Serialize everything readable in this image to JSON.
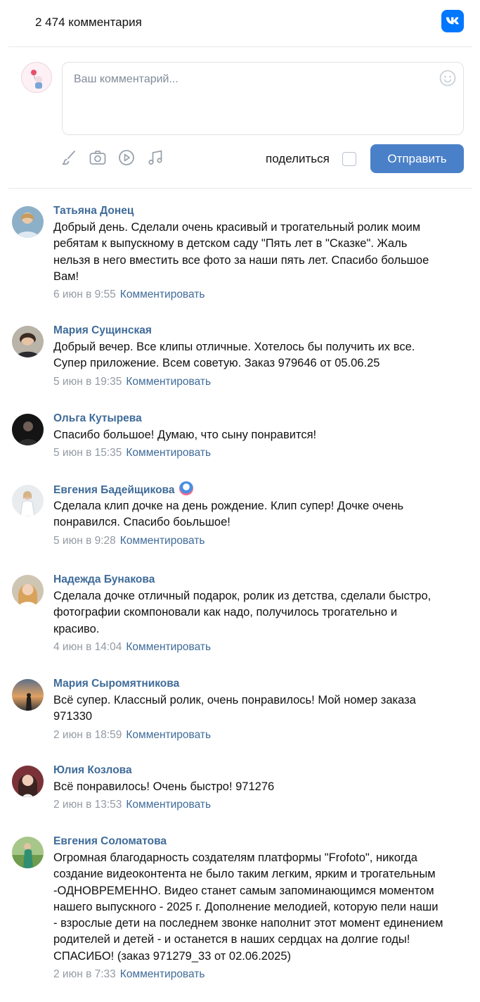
{
  "header": {
    "comment_count": "2 474 комментария",
    "logo_icon": "vk-logo-icon"
  },
  "composer": {
    "placeholder": "Ваш комментарий...",
    "emoji_icon": "smile-icon",
    "attachments": [
      "brush-icon",
      "camera-icon",
      "play-icon",
      "music-icon"
    ],
    "share_label": "поделиться",
    "send_label": "Отправить"
  },
  "colors": {
    "accent": "#4a80c8",
    "author": "#3f6b99",
    "meta": "#939aa3",
    "vk_brand": "#0077ff"
  },
  "comments": [
    {
      "author": "Татьяна Донец",
      "text": "Добрый день. Сделали очень красивый и трогательный ролик моим\nребятам к выпускному в детском саду \"Пять лет в \"Сказке\". Жаль\nнельзя в него вместить все фото за наши пять лет. Спасибо большое\nВам!",
      "date": "6 июн в 9:55",
      "reply": "Комментировать"
    },
    {
      "author": "Мария Сущинская",
      "text": "Добрый вечер. Все клипы отличные. Хотелось бы получить их все.\nСупер приложение. Всем советую. Заказ 979646 от 05.06.25",
      "date": "5 июн в 19:35",
      "reply": "Комментировать"
    },
    {
      "author": "Ольга Кутырева",
      "text": "Спасибо большое! Думаю, что сыну понравится!",
      "date": "5 июн в 15:35",
      "reply": "Комментировать"
    },
    {
      "author": "Евгения Бадейщикова",
      "text": "Сделала клип дочке на день рождение. Клип супер! Дочке очень\nпонравился. Спасибо боьльшое!",
      "date": "5 июн в 9:28",
      "reply": "Комментировать"
    },
    {
      "author": "Надежда Бунакова",
      "text": "Сделала дочке отличный подарок, ролик из детства, сделали быстро,\nфотографии скомпоновали как надо, получилось трогательно и\nкрасиво.",
      "date": "4 июн в 14:04",
      "reply": "Комментировать"
    },
    {
      "author": "Мария Сыромятникова",
      "text": "Всё супер. Классный ролик, очень понравилось! Мой номер заказа\n971330",
      "date": "2 июн в 18:59",
      "reply": "Комментировать"
    },
    {
      "author": "Юлия Козлова",
      "text": "Всё понравилось! Очень быстро! 971276",
      "date": "2 июн в 13:53",
      "reply": "Комментировать"
    },
    {
      "author": "Евгения Соломатова",
      "text": "Огромная благодарность создателям платформы \"Frofoto\", никогда\nсоздание видеоконтента не было таким легким, ярким и трогательным\n-ОДНОВРЕМЕННО. Видео станет самым запоминающимся моментом\nнашего выпускного - 2025 г. Дополнение мелодией, которую пели наши\n- взрослые дети на последнем звонке наполнит этот момент единением\nродителей и детей - и останется в наших сердцах на долгие годы!\nСПАСИБО! (заказ 971279_33 от 02.06.2025)",
      "date": "2 июн в 7:33",
      "reply": "Комментировать"
    }
  ]
}
